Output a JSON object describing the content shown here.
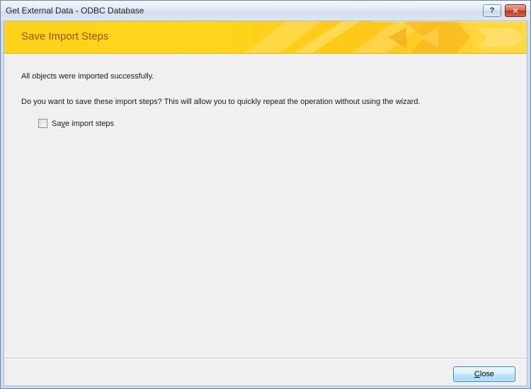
{
  "window": {
    "title": "Get External Data - ODBC Database",
    "help_label": "?",
    "close_glyph": "✕"
  },
  "banner": {
    "title": "Save Import Steps"
  },
  "content": {
    "success_message": "All objects were imported successfully.",
    "save_question": "Do you want to save these import steps? This will allow you to quickly repeat the operation without using the wizard.",
    "save_checkbox": {
      "label_before": "Sa",
      "label_accel": "v",
      "label_after": "e import steps",
      "checked": false
    }
  },
  "footer": {
    "close_accel": "C",
    "close_rest": "lose"
  },
  "colors": {
    "banner": "#ffd21c",
    "banner_title": "#a0501a",
    "client_bg": "#f0f0f0"
  },
  "icons": [
    "help-icon",
    "close-icon"
  ]
}
